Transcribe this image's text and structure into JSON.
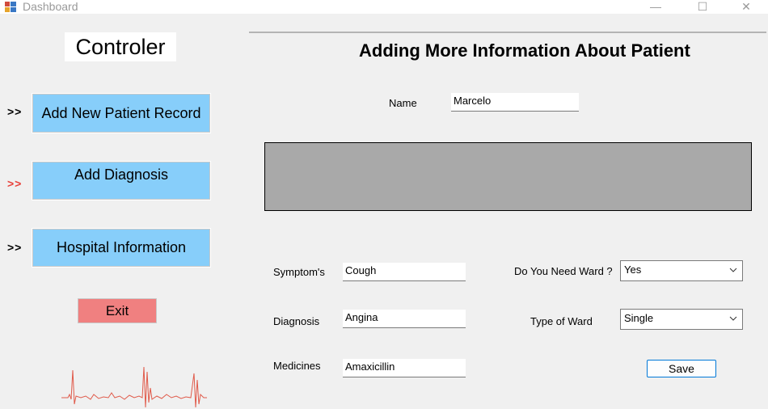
{
  "window": {
    "title": "Dashboard",
    "minimize": "—",
    "maximize": "☐",
    "close": "✕"
  },
  "sidebar": {
    "title": "Controler",
    "items": [
      {
        "arrow": ">>",
        "label": "Add New Patient Record",
        "arrow_color": "#000000"
      },
      {
        "arrow": ">>",
        "label": "Add Diagnosis",
        "arrow_color": "#e8403a"
      },
      {
        "arrow": ">>",
        "label": "Hospital Information",
        "arrow_color": "#000000"
      }
    ],
    "exit_label": "Exit"
  },
  "main": {
    "heading": "Adding More Information About Patient",
    "name_label": "Name",
    "name_value": "Marcelo",
    "symptoms_label": "Symptom's",
    "symptoms_value": "Cough",
    "diagnosis_label": "Diagnosis",
    "diagnosis_value": "Angina",
    "medicines_label": "Medicines",
    "medicines_value": "Amaxicillin",
    "ward_question_label": "Do You Need Ward ?",
    "ward_question_value": "Yes",
    "ward_type_label": "Type of  Ward",
    "ward_type_value": "Single",
    "save_label": "Save"
  },
  "colors": {
    "nav_button": "#87cefa",
    "exit_button": "#f08080",
    "panel_gray": "#a9a9a9",
    "ecg_line": "#e05a4a"
  }
}
